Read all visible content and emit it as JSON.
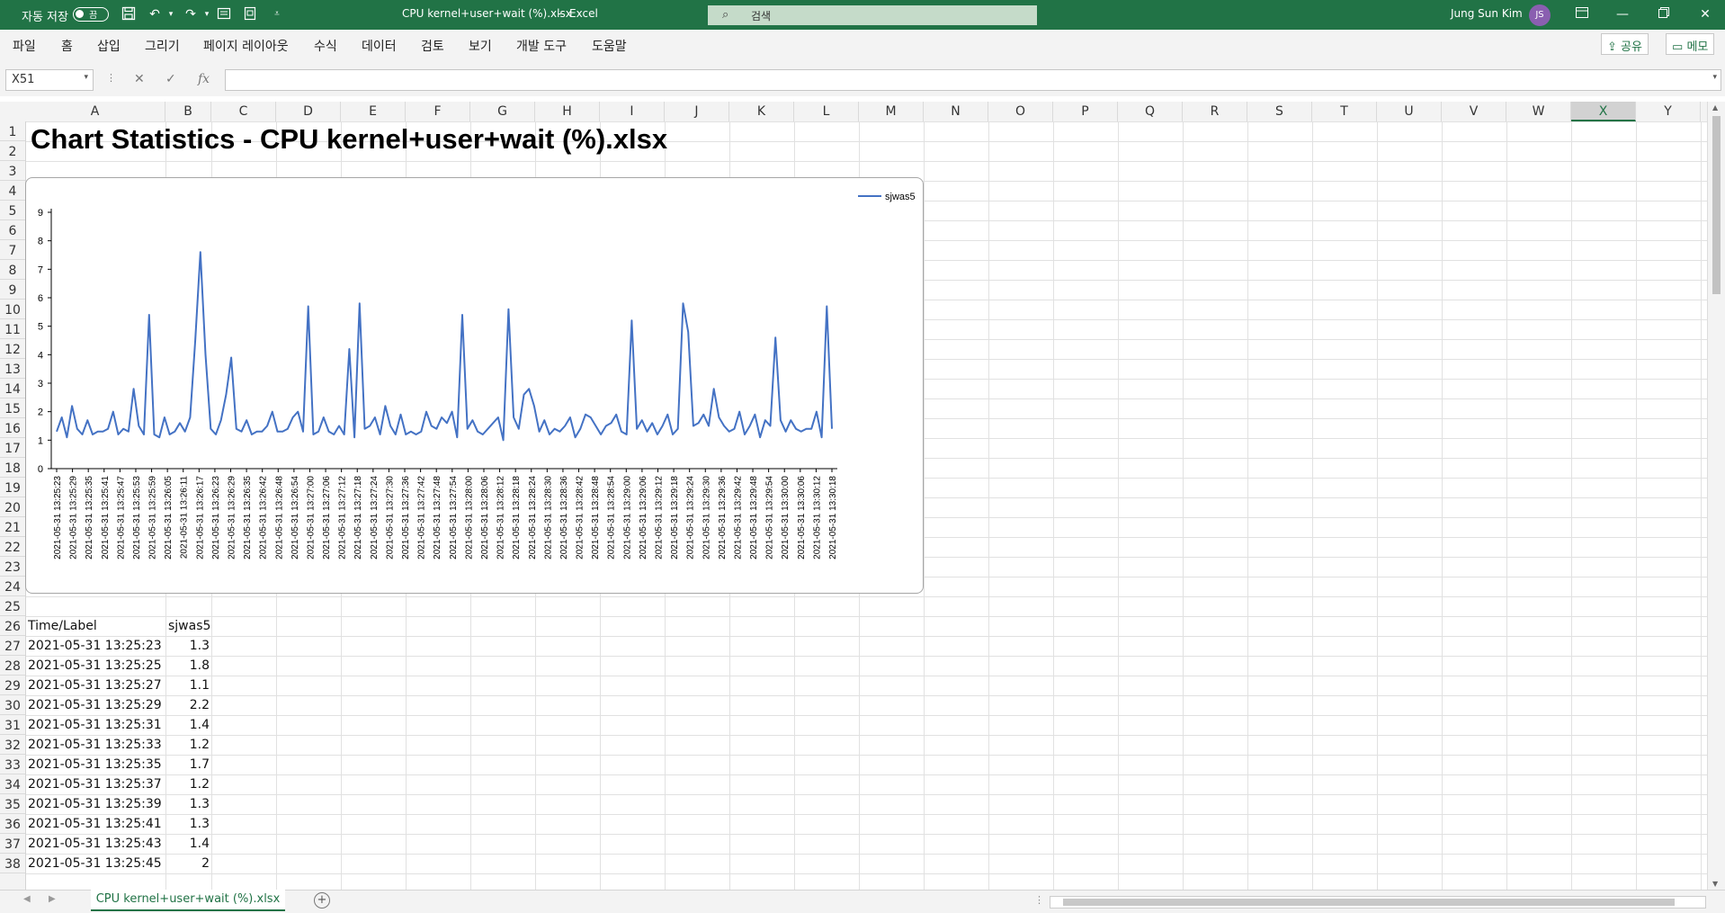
{
  "titlebar": {
    "autosave_label": "자동 저장",
    "autosave_state": "끔",
    "filename": "CPU kernel+user+wait (%).xlsx",
    "separator": "-",
    "app": "Excel",
    "search_placeholder": "검색",
    "user_name": "Jung Sun Kim",
    "user_initials": "JS"
  },
  "menu": {
    "items": [
      "파일",
      "홈",
      "삽입",
      "그리기",
      "페이지 레이아웃",
      "수식",
      "데이터",
      "검토",
      "보기",
      "개발 도구",
      "도움말"
    ],
    "share": "공유",
    "comments": "메모"
  },
  "formula_bar": {
    "name_box": "X51",
    "formula": ""
  },
  "columns": [
    "A",
    "B",
    "C",
    "D",
    "E",
    "F",
    "G",
    "H",
    "I",
    "J",
    "K",
    "L",
    "M",
    "N",
    "O",
    "P",
    "Q",
    "R",
    "S",
    "T",
    "U",
    "V",
    "W",
    "X",
    "Y"
  ],
  "selected_column": "X",
  "rows": [
    "1",
    "2",
    "3",
    "4",
    "5",
    "6",
    "7",
    "8",
    "9",
    "10",
    "11",
    "12",
    "13",
    "14",
    "15",
    "16",
    "17",
    "18",
    "19",
    "20",
    "21",
    "22",
    "23",
    "24",
    "25",
    "26",
    "27",
    "28",
    "29",
    "30",
    "31",
    "32",
    "33",
    "34",
    "35",
    "36",
    "37",
    "38"
  ],
  "sheet_title": "Chart Statistics - CPU kernel+user+wait (%).xlsx",
  "table": {
    "header": [
      "Time/Label",
      "sjwas5"
    ],
    "rows": [
      [
        "2021-05-31 13:25:23",
        "1.3"
      ],
      [
        "2021-05-31 13:25:25",
        "1.8"
      ],
      [
        "2021-05-31 13:25:27",
        "1.1"
      ],
      [
        "2021-05-31 13:25:29",
        "2.2"
      ],
      [
        "2021-05-31 13:25:31",
        "1.4"
      ],
      [
        "2021-05-31 13:25:33",
        "1.2"
      ],
      [
        "2021-05-31 13:25:35",
        "1.7"
      ],
      [
        "2021-05-31 13:25:37",
        "1.2"
      ],
      [
        "2021-05-31 13:25:39",
        "1.3"
      ],
      [
        "2021-05-31 13:25:41",
        "1.3"
      ],
      [
        "2021-05-31 13:25:43",
        "1.4"
      ],
      [
        "2021-05-31 13:25:45",
        "2"
      ]
    ]
  },
  "chart_data": {
    "type": "line",
    "title": "",
    "xlabel": "",
    "ylabel": "",
    "ylim": [
      0,
      9
    ],
    "yticks": [
      0,
      1,
      2,
      3,
      4,
      5,
      6,
      7,
      8,
      9
    ],
    "legend": "top-right",
    "grid": false,
    "line_color": "#4472c4",
    "x_tick_labels": [
      "2021-05-31 13:25:23",
      "2021-05-31 13:25:29",
      "2021-05-31 13:25:35",
      "2021-05-31 13:25:41",
      "2021-05-31 13:25:47",
      "2021-05-31 13:25:53",
      "2021-05-31 13:25:59",
      "2021-05-31 13:26:05",
      "2021-05-31 13:26:11",
      "2021-05-31 13:26:17",
      "2021-05-31 13:26:23",
      "2021-05-31 13:26:29",
      "2021-05-31 13:26:35",
      "2021-05-31 13:26:42",
      "2021-05-31 13:26:48",
      "2021-05-31 13:26:54",
      "2021-05-31 13:27:00",
      "2021-05-31 13:27:06",
      "2021-05-31 13:27:12",
      "2021-05-31 13:27:18",
      "2021-05-31 13:27:24",
      "2021-05-31 13:27:30",
      "2021-05-31 13:27:36",
      "2021-05-31 13:27:42",
      "2021-05-31 13:27:48",
      "2021-05-31 13:27:54",
      "2021-05-31 13:28:00",
      "2021-05-31 13:28:06",
      "2021-05-31 13:28:12",
      "2021-05-31 13:28:18",
      "2021-05-31 13:28:24",
      "2021-05-31 13:28:30",
      "2021-05-31 13:28:36",
      "2021-05-31 13:28:42",
      "2021-05-31 13:28:48",
      "2021-05-31 13:28:54",
      "2021-05-31 13:29:00",
      "2021-05-31 13:29:06",
      "2021-05-31 13:29:12",
      "2021-05-31 13:29:18",
      "2021-05-31 13:29:24",
      "2021-05-31 13:29:30",
      "2021-05-31 13:29:36",
      "2021-05-31 13:29:42",
      "2021-05-31 13:29:48",
      "2021-05-31 13:29:54",
      "2021-05-31 13:30:00",
      "2021-05-31 13:30:06",
      "2021-05-31 13:30:12",
      "2021-05-31 13:30:18"
    ],
    "series": [
      {
        "name": "sjwas5",
        "values": [
          1.3,
          1.8,
          1.1,
          2.2,
          1.4,
          1.2,
          1.7,
          1.2,
          1.3,
          1.3,
          1.4,
          2.0,
          1.2,
          1.4,
          1.3,
          2.8,
          1.5,
          1.2,
          5.4,
          1.2,
          1.1,
          1.8,
          1.2,
          1.3,
          1.6,
          1.3,
          1.8,
          4.5,
          7.6,
          4.0,
          1.4,
          1.2,
          1.7,
          2.6,
          3.9,
          1.4,
          1.3,
          1.7,
          1.2,
          1.3,
          1.3,
          1.5,
          2.0,
          1.3,
          1.3,
          1.4,
          1.8,
          2.0,
          1.3,
          5.7,
          1.2,
          1.3,
          1.8,
          1.3,
          1.2,
          1.5,
          1.2,
          4.2,
          1.1,
          5.8,
          1.4,
          1.5,
          1.8,
          1.2,
          2.2,
          1.5,
          1.2,
          1.9,
          1.2,
          1.3,
          1.2,
          1.3,
          2.0,
          1.5,
          1.4,
          1.8,
          1.6,
          2.0,
          1.1,
          5.4,
          1.4,
          1.7,
          1.3,
          1.2,
          1.4,
          1.6,
          1.8,
          1.0,
          5.6,
          1.8,
          1.4,
          2.6,
          2.8,
          2.2,
          1.3,
          1.7,
          1.2,
          1.4,
          1.3,
          1.5,
          1.8,
          1.1,
          1.4,
          1.9,
          1.8,
          1.5,
          1.2,
          1.5,
          1.6,
          1.9,
          1.3,
          1.2,
          5.2,
          1.4,
          1.7,
          1.3,
          1.6,
          1.2,
          1.5,
          1.9,
          1.2,
          1.4,
          5.8,
          4.8,
          1.5,
          1.6,
          1.9,
          1.5,
          2.8,
          1.8,
          1.5,
          1.3,
          1.4,
          2.0,
          1.2,
          1.5,
          1.9,
          1.1,
          1.7,
          1.5,
          4.6,
          1.7,
          1.3,
          1.7,
          1.4,
          1.3,
          1.4,
          1.4,
          2.0,
          1.1,
          5.7,
          1.4
        ]
      }
    ]
  }
}
